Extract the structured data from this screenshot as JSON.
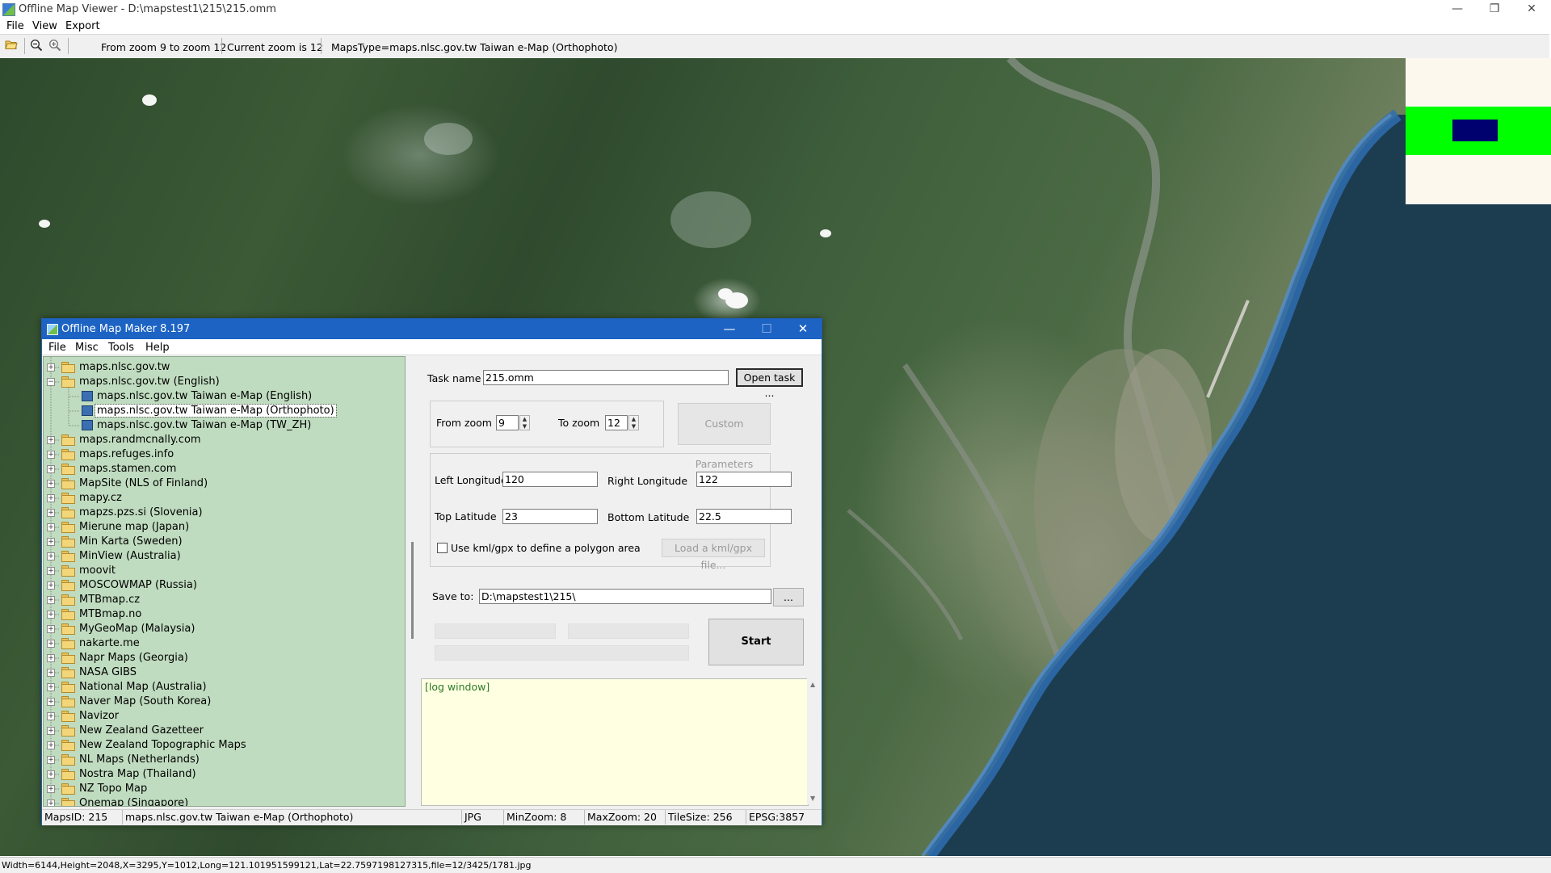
{
  "window": {
    "title": "Offline Map Viewer - D:\\mapstest1\\215\\215.omm",
    "minimize": "—",
    "restore": "❐",
    "close": "✕"
  },
  "menu": [
    "File",
    "View",
    "Export"
  ],
  "toolbar": {
    "zoom_range": "From zoom 9 to zoom 12",
    "current_zoom": "Current zoom is 12",
    "maps_type": "MapsType=maps.nlsc.gov.tw Taiwan e-Map (Orthophoto)"
  },
  "status_bar": "Width=6144,Height=2048,X=3295,Y=1012,Long=121.101951599121,Lat=22.7597198127315,file=12/3425/1781.jpg",
  "overview": {
    "colors": {
      "background": "#fdf8ee",
      "band": "#00ff00",
      "viewport": "#00006e"
    }
  },
  "dialog": {
    "title": "Offline Map Maker 8.197",
    "menu": [
      "File",
      "Misc",
      "Tools",
      "Help"
    ],
    "tree": [
      {
        "label": "maps.nlsc.gov.tw",
        "level": 0,
        "kind": "folder",
        "expanded": false
      },
      {
        "label": "maps.nlsc.gov.tw (English)",
        "level": 0,
        "kind": "folder",
        "expanded": true
      },
      {
        "label": "maps.nlsc.gov.tw Taiwan e-Map (English)",
        "level": 1,
        "kind": "map"
      },
      {
        "label": "maps.nlsc.gov.tw Taiwan e-Map (Orthophoto)",
        "level": 1,
        "kind": "map",
        "selected": true
      },
      {
        "label": "maps.nlsc.gov.tw Taiwan e-Map (TW_ZH)",
        "level": 1,
        "kind": "map"
      },
      {
        "label": "maps.randmcnally.com",
        "level": 0,
        "kind": "folder",
        "expanded": false
      },
      {
        "label": "maps.refuges.info",
        "level": 0,
        "kind": "folder",
        "expanded": false
      },
      {
        "label": "maps.stamen.com",
        "level": 0,
        "kind": "folder",
        "expanded": false
      },
      {
        "label": "MapSite (NLS of Finland)",
        "level": 0,
        "kind": "folder",
        "expanded": false
      },
      {
        "label": "mapy.cz",
        "level": 0,
        "kind": "folder",
        "expanded": false
      },
      {
        "label": "mapzs.pzs.si (Slovenia)",
        "level": 0,
        "kind": "folder",
        "expanded": false
      },
      {
        "label": "Mierune map (Japan)",
        "level": 0,
        "kind": "folder",
        "expanded": false
      },
      {
        "label": "Min Karta (Sweden)",
        "level": 0,
        "kind": "folder",
        "expanded": false
      },
      {
        "label": "MinView (Australia)",
        "level": 0,
        "kind": "folder",
        "expanded": false
      },
      {
        "label": "moovit",
        "level": 0,
        "kind": "folder",
        "expanded": false
      },
      {
        "label": "MOSCOWMAP (Russia)",
        "level": 0,
        "kind": "folder",
        "expanded": false
      },
      {
        "label": "MTBmap.cz",
        "level": 0,
        "kind": "folder",
        "expanded": false
      },
      {
        "label": "MTBmap.no",
        "level": 0,
        "kind": "folder",
        "expanded": false
      },
      {
        "label": "MyGeoMap (Malaysia)",
        "level": 0,
        "kind": "folder",
        "expanded": false
      },
      {
        "label": "nakarte.me",
        "level": 0,
        "kind": "folder",
        "expanded": false
      },
      {
        "label": "Napr Maps (Georgia)",
        "level": 0,
        "kind": "folder",
        "expanded": false
      },
      {
        "label": "NASA GIBS",
        "level": 0,
        "kind": "folder",
        "expanded": false
      },
      {
        "label": "National Map (Australia)",
        "level": 0,
        "kind": "folder",
        "expanded": false
      },
      {
        "label": "Naver Map (South Korea)",
        "level": 0,
        "kind": "folder",
        "expanded": false
      },
      {
        "label": "Navizor",
        "level": 0,
        "kind": "folder",
        "expanded": false
      },
      {
        "label": "New Zealand Gazetteer",
        "level": 0,
        "kind": "folder",
        "expanded": false
      },
      {
        "label": "New Zealand Topographic Maps",
        "level": 0,
        "kind": "folder",
        "expanded": false
      },
      {
        "label": "NL Maps (Netherlands)",
        "level": 0,
        "kind": "folder",
        "expanded": false
      },
      {
        "label": "Nostra Map (Thailand)",
        "level": 0,
        "kind": "folder",
        "expanded": false
      },
      {
        "label": "NZ Topo Map",
        "level": 0,
        "kind": "folder",
        "expanded": false
      },
      {
        "label": "Onemap (Singapore)",
        "level": 0,
        "kind": "folder",
        "expanded": false
      }
    ],
    "task_name": {
      "label": "Task name",
      "value": "215.omm"
    },
    "open_task": "Open task ...",
    "from_zoom": {
      "label": "From zoom",
      "value": "9"
    },
    "to_zoom": {
      "label": "To zoom",
      "value": "12"
    },
    "custom_params": "Custom Parameters",
    "left_longitude": {
      "label": "Left Longitude",
      "value": "120"
    },
    "right_longitude": {
      "label": "Right Longitude",
      "value": "122"
    },
    "top_latitude": {
      "label": "Top Latitude",
      "value": "23"
    },
    "bottom_latitude": {
      "label": "Bottom Latitude",
      "value": "22.5"
    },
    "use_kml": "Use kml/gpx to define a polygon area",
    "load_kml": "Load a kml/gpx file...",
    "save_to": {
      "label": "Save to:",
      "value": "D:\\mapstest1\\215\\"
    },
    "browse": "...",
    "start": "Start",
    "log": "[log window]",
    "status": {
      "maps_id": "MapsID: 215",
      "map_name": "maps.nlsc.gov.tw Taiwan e-Map (Orthophoto)",
      "format": "JPG",
      "min_zoom": "MinZoom: 8",
      "max_zoom": "MaxZoom: 20",
      "tile_size": "TileSize: 256",
      "epsg": "EPSG:3857"
    }
  }
}
